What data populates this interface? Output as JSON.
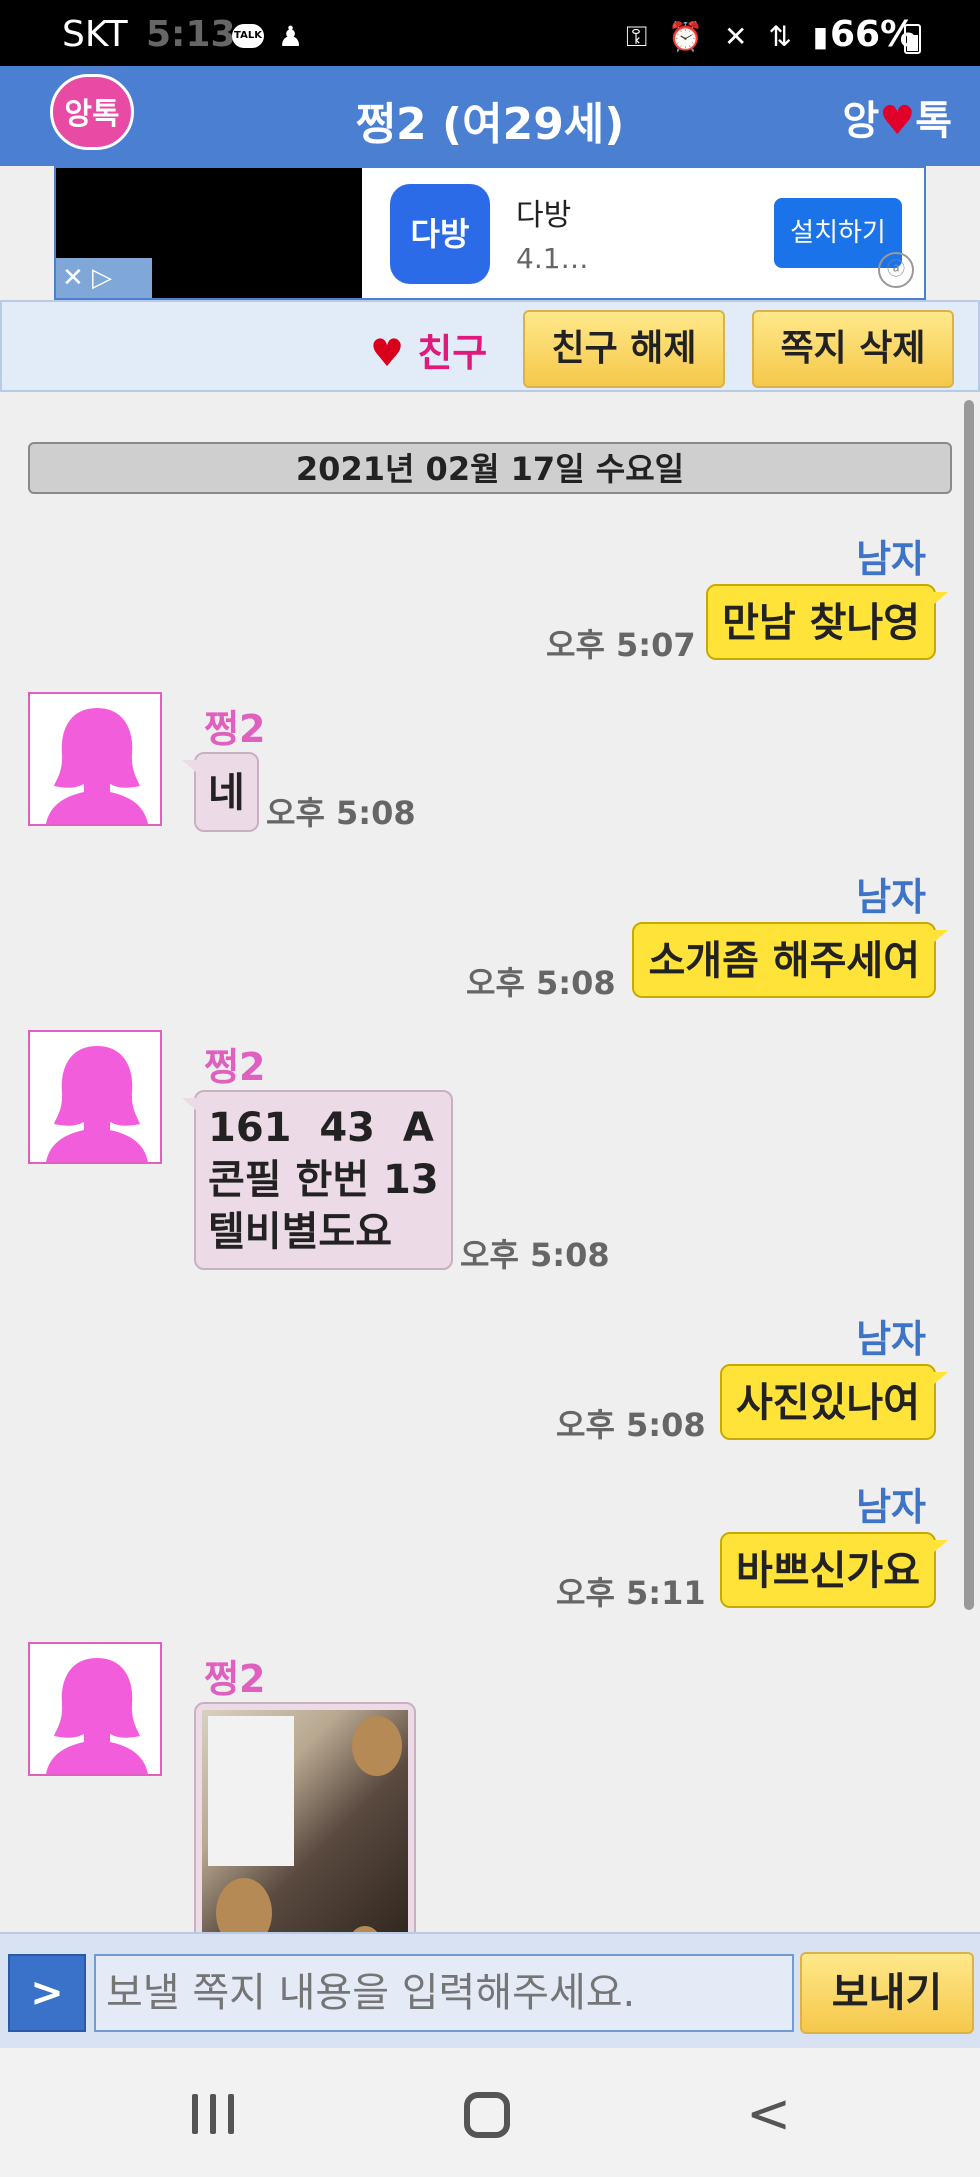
{
  "status_bar": {
    "carrier": "SKT",
    "time": "5:13",
    "talk_badge": "TALK",
    "battery": "66%"
  },
  "header": {
    "logo": "앙톡",
    "title": "쩡2 (여29세)",
    "brand_left": "앙",
    "brand_heart": "♥",
    "brand_right": "톡"
  },
  "ad": {
    "app_name": "다방",
    "app_logo_text": "다방",
    "rating": "4.1…",
    "install_label": "설치하기"
  },
  "friend_bar": {
    "status_heart": "♥",
    "status_label": "친구",
    "unfriend_label": "친구 해제",
    "delete_label": "쪽지 삭제"
  },
  "date_divider": "2021년 02월 17일 수요일",
  "messages": [
    {
      "sender": "남자",
      "text": "만남 찾나영",
      "time": "오후 5:07"
    },
    {
      "sender": "쩡2",
      "text": "네",
      "time": "오후 5:08"
    },
    {
      "sender": "남자",
      "text": "소개좀 해주세여",
      "time": "오후 5:08"
    },
    {
      "sender": "쩡2",
      "lines": [
        "161  43  A",
        "콘필 한번 13",
        "텔비별도요"
      ],
      "time": "오후 5:08"
    },
    {
      "sender": "남자",
      "text": "사진있나여",
      "time": "오후 5:08"
    },
    {
      "sender": "남자",
      "text": "바쁘신가요",
      "time": "오후 5:11"
    },
    {
      "sender": "쩡2",
      "type": "photo"
    }
  ],
  "input_bar": {
    "toggle_label": ">",
    "placeholder": "보낼 쪽지 내용을 입력해주세요.",
    "send_label": "보내기"
  },
  "colors": {
    "header_blue": "#4a7fd2",
    "my_bubble": "#ffe338",
    "her_bubble": "#ecdbe7",
    "female_name": "#e060c0",
    "male_name": "#3d74c7"
  }
}
